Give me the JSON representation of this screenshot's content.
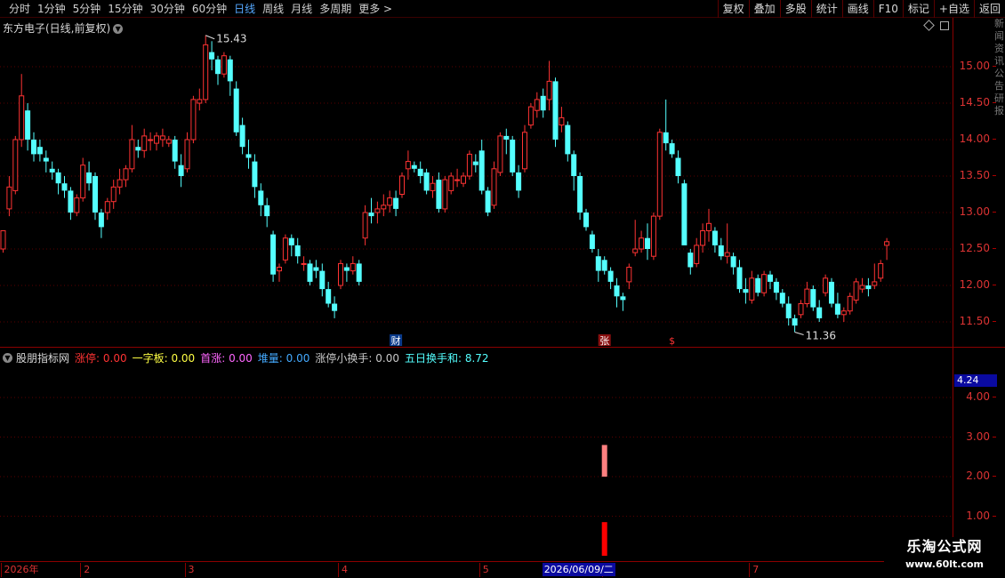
{
  "toolbar": {
    "periods": [
      {
        "label": "分时",
        "active": false
      },
      {
        "label": "1分钟",
        "active": false
      },
      {
        "label": "5分钟",
        "active": false
      },
      {
        "label": "15分钟",
        "active": false
      },
      {
        "label": "30分钟",
        "active": false
      },
      {
        "label": "60分钟",
        "active": false
      },
      {
        "label": "日线",
        "active": true
      },
      {
        "label": "周线",
        "active": false
      },
      {
        "label": "月线",
        "active": false
      },
      {
        "label": "多周期",
        "active": false
      },
      {
        "label": "更多 >",
        "active": false
      }
    ],
    "tools": [
      "复权",
      "叠加",
      "多股",
      "统计",
      "画线",
      "F10",
      "标记",
      "+自选",
      "返回"
    ]
  },
  "main_chart": {
    "title": "东方电子(日线,前复权)",
    "colors": {
      "up": "#ff3333",
      "down": "#54ffff",
      "grid": "#5a0000",
      "axis": "#dd3333"
    },
    "price_axis": {
      "ticks": [
        "15.00",
        "14.50",
        "14.00",
        "13.50",
        "13.00",
        "12.50",
        "12.00",
        "11.50"
      ]
    },
    "high_annotation": "15.43",
    "low_annotation": "11.36",
    "markers": [
      {
        "label": "财",
        "index": 64
      },
      {
        "label": "张",
        "index": 98
      },
      {
        "label": "$",
        "index": 109
      }
    ],
    "candles": [
      [
        12.5,
        12.75,
        12.45,
        12.75
      ],
      [
        13.05,
        13.5,
        12.95,
        13.35
      ],
      [
        13.3,
        14.05,
        13.25,
        14.0
      ],
      [
        14.0,
        14.9,
        13.9,
        14.6
      ],
      [
        14.4,
        14.5,
        13.85,
        14.0
      ],
      [
        14.0,
        14.1,
        13.7,
        13.8
      ],
      [
        13.9,
        14.0,
        13.7,
        13.8
      ],
      [
        13.75,
        13.85,
        13.55,
        13.7
      ],
      [
        13.6,
        13.7,
        13.45,
        13.55
      ],
      [
        13.55,
        13.6,
        13.25,
        13.4
      ],
      [
        13.4,
        13.5,
        13.2,
        13.3
      ],
      [
        13.3,
        13.35,
        12.9,
        13.0
      ],
      [
        13.0,
        13.25,
        12.95,
        13.2
      ],
      [
        13.2,
        13.75,
        13.15,
        13.65
      ],
      [
        13.55,
        13.7,
        13.3,
        13.4
      ],
      [
        13.5,
        13.55,
        12.9,
        13.0
      ],
      [
        13.0,
        13.05,
        12.65,
        12.8
      ],
      [
        13.0,
        13.2,
        12.9,
        13.15
      ],
      [
        13.15,
        13.45,
        13.05,
        13.35
      ],
      [
        13.35,
        13.6,
        13.25,
        13.45
      ],
      [
        13.45,
        13.65,
        13.35,
        13.6
      ],
      [
        13.6,
        14.2,
        13.55,
        14.0
      ],
      [
        13.9,
        14.0,
        13.75,
        13.85
      ],
      [
        13.85,
        14.15,
        13.75,
        14.05
      ],
      [
        14.0,
        14.1,
        13.85,
        14.0
      ],
      [
        13.95,
        14.1,
        13.85,
        14.05
      ],
      [
        14.0,
        14.15,
        13.9,
        14.05
      ],
      [
        13.95,
        14.05,
        13.9,
        14.0
      ],
      [
        14.0,
        14.05,
        13.6,
        13.7
      ],
      [
        13.65,
        13.8,
        13.35,
        13.5
      ],
      [
        13.6,
        14.1,
        13.55,
        14.0
      ],
      [
        14.0,
        14.6,
        13.95,
        14.55
      ],
      [
        14.5,
        14.7,
        14.4,
        14.55
      ],
      [
        14.55,
        15.43,
        14.5,
        15.3
      ],
      [
        15.2,
        15.35,
        14.95,
        15.1
      ],
      [
        15.1,
        15.15,
        14.75,
        14.9
      ],
      [
        14.9,
        15.2,
        14.85,
        15.15
      ],
      [
        15.1,
        15.15,
        14.6,
        14.8
      ],
      [
        14.7,
        14.8,
        14.05,
        14.1
      ],
      [
        14.2,
        14.3,
        13.8,
        13.9
      ],
      [
        13.8,
        14.0,
        13.6,
        13.75
      ],
      [
        13.7,
        13.8,
        13.2,
        13.35
      ],
      [
        13.3,
        13.4,
        12.95,
        13.1
      ],
      [
        13.1,
        13.2,
        12.8,
        12.95
      ],
      [
        12.7,
        12.75,
        12.05,
        12.15
      ],
      [
        12.2,
        12.3,
        12.05,
        12.25
      ],
      [
        12.35,
        12.7,
        12.3,
        12.65
      ],
      [
        12.65,
        12.7,
        12.4,
        12.55
      ],
      [
        12.55,
        12.65,
        12.3,
        12.4
      ],
      [
        12.3,
        12.4,
        12.2,
        12.3
      ],
      [
        12.3,
        12.35,
        12.0,
        12.05
      ],
      [
        12.25,
        12.35,
        12.1,
        12.2
      ],
      [
        12.2,
        12.3,
        11.85,
        11.95
      ],
      [
        11.95,
        12.05,
        11.7,
        11.75
      ],
      [
        11.75,
        11.85,
        11.55,
        11.65
      ],
      [
        12.0,
        12.35,
        11.95,
        12.3
      ],
      [
        12.25,
        12.3,
        12.05,
        12.2
      ],
      [
        12.2,
        12.4,
        12.15,
        12.3
      ],
      [
        12.3,
        12.35,
        12.0,
        12.05
      ],
      [
        12.65,
        13.1,
        12.55,
        13.0
      ],
      [
        13.0,
        13.2,
        12.85,
        12.95
      ],
      [
        13.0,
        13.15,
        12.85,
        13.05
      ],
      [
        13.05,
        13.25,
        12.95,
        13.1
      ],
      [
        13.1,
        13.3,
        13.0,
        13.2
      ],
      [
        13.2,
        13.3,
        12.95,
        13.05
      ],
      [
        13.25,
        13.55,
        13.2,
        13.5
      ],
      [
        13.6,
        13.85,
        13.45,
        13.7
      ],
      [
        13.65,
        13.7,
        13.55,
        13.6
      ],
      [
        13.6,
        13.7,
        13.4,
        13.5
      ],
      [
        13.55,
        13.6,
        13.25,
        13.3
      ],
      [
        13.3,
        13.5,
        13.2,
        13.4
      ],
      [
        13.45,
        13.55,
        13.0,
        13.05
      ],
      [
        13.05,
        13.5,
        13.0,
        13.45
      ],
      [
        13.3,
        13.55,
        13.25,
        13.5
      ],
      [
        13.45,
        13.6,
        13.35,
        13.45
      ],
      [
        13.4,
        13.55,
        13.35,
        13.5
      ],
      [
        13.5,
        13.85,
        13.45,
        13.8
      ],
      [
        13.7,
        13.8,
        13.55,
        13.65
      ],
      [
        13.85,
        14.0,
        13.25,
        13.3
      ],
      [
        13.3,
        13.35,
        12.95,
        13.0
      ],
      [
        13.1,
        13.7,
        13.05,
        13.6
      ],
      [
        13.55,
        14.1,
        13.5,
        14.05
      ],
      [
        14.05,
        14.15,
        13.8,
        14.0
      ],
      [
        14.0,
        14.05,
        13.5,
        13.55
      ],
      [
        13.55,
        13.65,
        13.2,
        13.3
      ],
      [
        13.6,
        14.2,
        13.55,
        14.1
      ],
      [
        14.2,
        14.5,
        14.15,
        14.45
      ],
      [
        14.4,
        14.65,
        14.3,
        14.55
      ],
      [
        14.6,
        14.7,
        14.3,
        14.4
      ],
      [
        14.55,
        15.08,
        14.4,
        14.8
      ],
      [
        14.8,
        14.85,
        13.9,
        14.0
      ],
      [
        14.2,
        14.45,
        14.1,
        14.3
      ],
      [
        14.2,
        14.25,
        13.7,
        13.8
      ],
      [
        13.8,
        13.85,
        13.3,
        13.5
      ],
      [
        13.5,
        13.55,
        12.9,
        13.0
      ],
      [
        13.0,
        13.05,
        12.75,
        12.8
      ],
      [
        12.7,
        12.75,
        12.45,
        12.5
      ],
      [
        12.4,
        12.5,
        12.05,
        12.2
      ],
      [
        12.35,
        12.4,
        12.15,
        12.2
      ],
      [
        12.2,
        12.25,
        11.95,
        12.05
      ],
      [
        12.0,
        12.1,
        11.7,
        11.85
      ],
      [
        11.85,
        11.9,
        11.65,
        11.8
      ],
      [
        12.05,
        12.3,
        11.95,
        12.25
      ],
      [
        12.45,
        12.9,
        12.4,
        12.5
      ],
      [
        12.5,
        12.75,
        12.45,
        12.65
      ],
      [
        12.65,
        12.85,
        12.35,
        12.5
      ],
      [
        12.4,
        13.0,
        12.35,
        12.95
      ],
      [
        12.95,
        14.15,
        12.9,
        14.1
      ],
      [
        14.1,
        14.55,
        13.85,
        13.95
      ],
      [
        13.95,
        14.0,
        13.75,
        13.8
      ],
      [
        13.75,
        13.85,
        13.4,
        13.5
      ],
      [
        13.4,
        13.45,
        12.85,
        12.55
      ],
      [
        12.45,
        12.5,
        12.15,
        12.25
      ],
      [
        12.3,
        12.65,
        12.25,
        12.55
      ],
      [
        12.55,
        12.85,
        12.45,
        12.75
      ],
      [
        12.75,
        13.05,
        12.6,
        12.85
      ],
      [
        12.75,
        12.8,
        12.45,
        12.55
      ],
      [
        12.55,
        12.65,
        12.35,
        12.4
      ],
      [
        12.4,
        12.85,
        12.3,
        12.45
      ],
      [
        12.4,
        12.45,
        12.15,
        12.25
      ],
      [
        12.25,
        12.35,
        11.9,
        11.95
      ],
      [
        11.95,
        12.1,
        11.75,
        11.9
      ],
      [
        11.8,
        12.2,
        11.75,
        12.1
      ],
      [
        12.1,
        12.15,
        11.85,
        11.9
      ],
      [
        11.9,
        12.2,
        11.85,
        12.15
      ],
      [
        12.15,
        12.2,
        11.95,
        12.05
      ],
      [
        12.05,
        12.1,
        11.8,
        11.9
      ],
      [
        11.9,
        11.95,
        11.7,
        11.75
      ],
      [
        11.75,
        11.85,
        11.45,
        11.55
      ],
      [
        11.55,
        11.6,
        11.36,
        11.45
      ],
      [
        11.6,
        11.8,
        11.55,
        11.75
      ],
      [
        11.75,
        12.05,
        11.7,
        11.95
      ],
      [
        11.95,
        12.0,
        11.65,
        11.7
      ],
      [
        11.7,
        11.8,
        11.5,
        11.55
      ],
      [
        11.9,
        12.15,
        11.85,
        12.1
      ],
      [
        12.05,
        12.1,
        11.7,
        11.75
      ],
      [
        11.75,
        11.9,
        11.55,
        11.6
      ],
      [
        11.6,
        11.7,
        11.5,
        11.65
      ],
      [
        11.65,
        11.9,
        11.6,
        11.85
      ],
      [
        11.8,
        12.1,
        11.75,
        12.05
      ],
      [
        11.95,
        12.1,
        11.9,
        12.0
      ],
      [
        12.0,
        12.1,
        11.85,
        11.95
      ],
      [
        12.0,
        12.3,
        11.95,
        12.05
      ],
      [
        12.1,
        12.35,
        12.05,
        12.3
      ],
      [
        12.55,
        12.65,
        12.35,
        12.6
      ]
    ]
  },
  "indicator": {
    "name": "股朋指标网",
    "series": [
      {
        "label": "涨停:",
        "value": "0.00",
        "color": "#ff3333"
      },
      {
        "label": "一字板:",
        "value": "0.00",
        "color": "#ffff44"
      },
      {
        "label": "首涨:",
        "value": "0.00",
        "color": "#ff66ff"
      },
      {
        "label": "堆量:",
        "value": "0.00",
        "color": "#44aaff"
      },
      {
        "label": "涨停小换手:",
        "value": "0.00",
        "color": "#c8c8c8"
      },
      {
        "label": "五日换手和:",
        "value": "8.72",
        "color": "#54ffff"
      }
    ],
    "axis_ticks": [
      "4.00",
      "3.00",
      "2.00",
      "1.00"
    ],
    "current_value": "4.24",
    "bars": [
      {
        "index": 98,
        "from": 2.0,
        "to": 2.8,
        "color": "#ff8080"
      },
      {
        "index": 98,
        "from": 0.0,
        "to": 0.85,
        "color": "#ff0000"
      }
    ]
  },
  "date_axis": {
    "labels": [
      {
        "text": "2026年",
        "index": 0
      },
      {
        "text": "2",
        "index": 13
      },
      {
        "text": "3",
        "index": 30
      },
      {
        "text": "4",
        "index": 55
      },
      {
        "text": "5",
        "index": 78
      },
      {
        "text": "6",
        "index": 98
      },
      {
        "text": "7",
        "index": 122
      }
    ],
    "cursor_date": "2026/06/09/二"
  },
  "watermark": {
    "title": "乐淘公式网",
    "url": "www.60lt.com"
  },
  "right_strip": "新闻资讯公告研报"
}
